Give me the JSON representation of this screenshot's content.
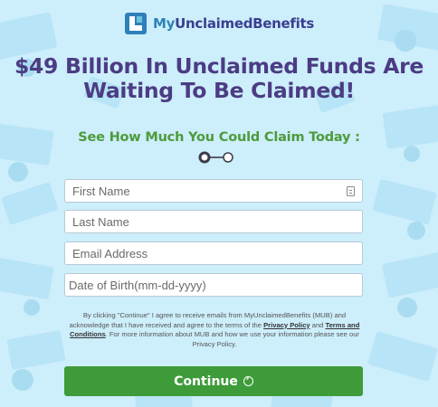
{
  "logo": {
    "text_my": "My",
    "text_rest": "UnclaimedBenefits"
  },
  "headline": {
    "line1": "$49 Billion In Unclaimed Funds Are",
    "line2": "Waiting To Be Claimed!"
  },
  "subhead": "See How Much You Could Claim Today :",
  "progress": {
    "current_step": 1,
    "total_steps": 2
  },
  "form": {
    "first_name_placeholder": "First Name",
    "last_name_placeholder": "Last Name",
    "email_placeholder": "Email Address",
    "dob_placeholder": "Date of Birth(mm-dd-yyyy)"
  },
  "disclaimer": {
    "part1": "By clicking \"Continue\" I agree to receive emails from MyUnclaimedBenefits (MUB) and acknowledge that I have received and agree to the terms of the ",
    "privacy_link": "Privacy Policy",
    "part2": " and ",
    "terms_link": "Terms and Conditions",
    "part3": ". For more information about MUB and how we use your information please see our Privacy Policy."
  },
  "button": {
    "label": "Continue"
  },
  "colors": {
    "background": "#cdeefb",
    "headline": "#4b3c83",
    "accent_green": "#3e9b3a",
    "logo_blue": "#2d83b8"
  }
}
